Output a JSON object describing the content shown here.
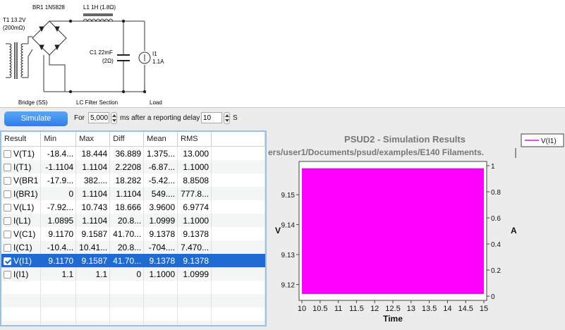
{
  "schematic": {
    "labels": {
      "transformer": "T1 13.2V",
      "transformer_resistance": "(200mΩ)",
      "bridge": "BR1 1N5828",
      "inductor": "L1 1H (1.8Ω)",
      "capacitor": "C1 22mF",
      "capacitor_esr": "(2Ω)",
      "load_name": "I1",
      "load_value": "1.1A",
      "section_bridge": "Bridge (SS)",
      "section_filter": "LC Filter Section",
      "section_load": "Load"
    }
  },
  "toolbar": {
    "simulate_label": "Simulate",
    "for_label": "For",
    "duration_value": "5,000",
    "after_label": "ms after a reporting delay",
    "delay_value": "10",
    "unit_label": "S"
  },
  "table": {
    "headers": [
      "Result",
      "Min",
      "Max",
      "Diff",
      "Mean",
      "RMS"
    ],
    "rows": [
      {
        "name": "V(T1)",
        "checked": false,
        "min": "-18.4...",
        "max": "18.444",
        "diff": "36.889",
        "mean": "1.375...",
        "rms": "13.000"
      },
      {
        "name": "I(T1)",
        "checked": false,
        "min": "-1.1104",
        "max": "1.1104",
        "diff": "2.2208",
        "mean": "-6.87...",
        "rms": "1.1000"
      },
      {
        "name": "V(BR1",
        "checked": false,
        "min": "-17.9...",
        "max": "382....",
        "diff": "18.282",
        "mean": "-5.42...",
        "rms": "8.8508"
      },
      {
        "name": "I(BR1)",
        "checked": false,
        "min": "0",
        "max": "1.1104",
        "diff": "1.1104",
        "mean": "549....",
        "rms": "777.8..."
      },
      {
        "name": "V(L1)",
        "checked": false,
        "min": "-7.92...",
        "max": "10.743",
        "diff": "18.666",
        "mean": "3.9600",
        "rms": "6.9774"
      },
      {
        "name": "I(L1)",
        "checked": false,
        "min": "1.0895",
        "max": "1.1104",
        "diff": "20.8...",
        "mean": "1.0999",
        "rms": "1.1000"
      },
      {
        "name": "V(C1)",
        "checked": false,
        "min": "9.1170",
        "max": "9.1587",
        "diff": "41.70...",
        "mean": "9.1378",
        "rms": "9.1378"
      },
      {
        "name": "I(C1)",
        "checked": false,
        "min": "-10.4...",
        "max": "10.41...",
        "diff": "20.8...",
        "mean": "-704....",
        "rms": "7.470..."
      },
      {
        "name": "V(I1)",
        "checked": true,
        "min": "9.1170",
        "max": "9.1587",
        "diff": "41.70...",
        "mean": "9.1378",
        "rms": "9.1378"
      },
      {
        "name": "I(I1)",
        "checked": false,
        "min": "1.1",
        "max": "1.1",
        "diff": "0",
        "mean": "1.1000",
        "rms": "1.0999"
      }
    ],
    "selected_index": 8,
    "empty_rows": 4
  },
  "chart_data": {
    "type": "area",
    "title": "PSUD2 - Simulation Results",
    "subtitle": "ers/user1/Documents/psud/examples/E140 Filaments.",
    "xlabel": "Time",
    "ylabel": "V",
    "y2label": "A",
    "xlim": [
      10,
      15
    ],
    "ylim": [
      9.1147,
      9.1611
    ],
    "y2lim": [
      0,
      1
    ],
    "x_ticks": [
      "10",
      "10.5",
      "11",
      "11.5",
      "12",
      "12.5",
      "13",
      "13.5",
      "14",
      "14.5",
      "15"
    ],
    "y_ticks": [
      "9.12",
      "9.13",
      "9.14",
      "9.15"
    ],
    "y2_ticks": [
      "0",
      "0.2",
      "0.4",
      "0.6",
      "0.8",
      "1"
    ],
    "grid": false,
    "legend_position": "top-right",
    "series": [
      {
        "name": "V(I1)",
        "color": "#ff00ff",
        "y_min": 9.117,
        "y_max": 9.1587
      }
    ]
  },
  "colors": {
    "accent": "#1f6bd1",
    "trace": "#ff00ff"
  }
}
